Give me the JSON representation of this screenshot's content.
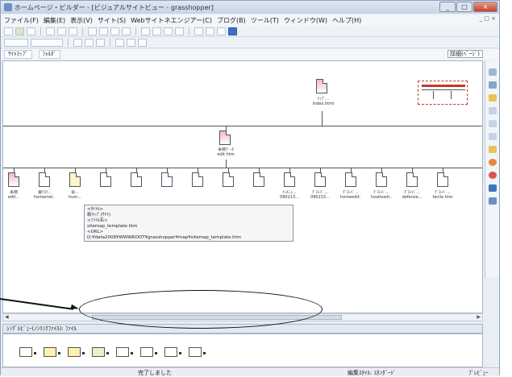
{
  "window": {
    "title": "ホームページ・ビルダー - [ビジュアルサイトビュー - grasshopper]",
    "buttons": [
      "_",
      "□",
      "×"
    ]
  },
  "menubar": {
    "items": [
      "ファイル(F)",
      "編集(E)",
      "表示(V)",
      "サイト(S)",
      "Webサイトネエンジアー(C)",
      "ブログ(B)",
      "ツール(T)",
      "ウィンドウ(W)",
      "ヘルプ(H)"
    ],
    "mdi_controls": "_ □ ×"
  },
  "tabs": {
    "items": [
      "ｻｲﾄﾏｯﾌﾟ",
      "ﾌｫﾙﾀﾞ"
    ],
    "view_select": "詳細(ﾍﾞｰｼﾞ)"
  },
  "sitemap": {
    "root_label": "ﾄｯﾌﾟ... index.html",
    "level1_label": "事務ﾃﾞｰﾀ",
    "level1_file": "edit.htm",
    "children": [
      {
        "name": "事務",
        "file": "edit..."
      },
      {
        "name": "最ﾃｽﾄ..",
        "file": "homemel..."
      },
      {
        "name": "会...",
        "file": "hum..."
      },
      {
        "name": "",
        "file": ""
      },
      {
        "name": "",
        "file": ""
      },
      {
        "name": "",
        "file": ""
      },
      {
        "name": "",
        "file": ""
      },
      {
        "name": "",
        "file": ""
      },
      {
        "name": "",
        "file": ""
      },
      {
        "name": "ﾒｰﾙﾆｭ...",
        "file": "090213..."
      },
      {
        "name": "ｸﾞﾛｰﾊﾞ...",
        "file": "090215..."
      },
      {
        "name": "ｸﾞﾛｰﾊﾞ...",
        "file": "homeedit..."
      },
      {
        "name": "ｸﾞﾛｰﾊﾞ...",
        "file": "howtoedi..."
      },
      {
        "name": "ｸﾞﾛｰﾊﾞ...",
        "file": "defense..."
      },
      {
        "name": "ｸﾞﾛｰﾊﾞ...",
        "file": "facile.htm"
      }
    ]
  },
  "tooltip": {
    "lines": [
      "<ﾀｲﾄﾙ>",
      "新ﾏｯﾌﾟ(ｻｲﾄ)",
      "<ﾌｧｲﾙ名>",
      "sitemap_template.htm",
      "<URL>",
      "D:¥data2008¥WWWROOT¥grasshopper¥map¥sitemap_template.htm"
    ]
  },
  "panel": {
    "title": "ｼﾝｸﾞﾙﾋﾞｭｰ(ﾉﾝﾘﾝｸﾌｧｲﾙ): ﾌｧｲﾙ"
  },
  "statusbar": {
    "left": "完了しました",
    "mid": "編集ｽﾀｲﾙ: ｽﾀﾝﾀﾞｰﾄﾞ",
    "right": "ﾌﾟﾚﾋﾞｭｰ"
  }
}
